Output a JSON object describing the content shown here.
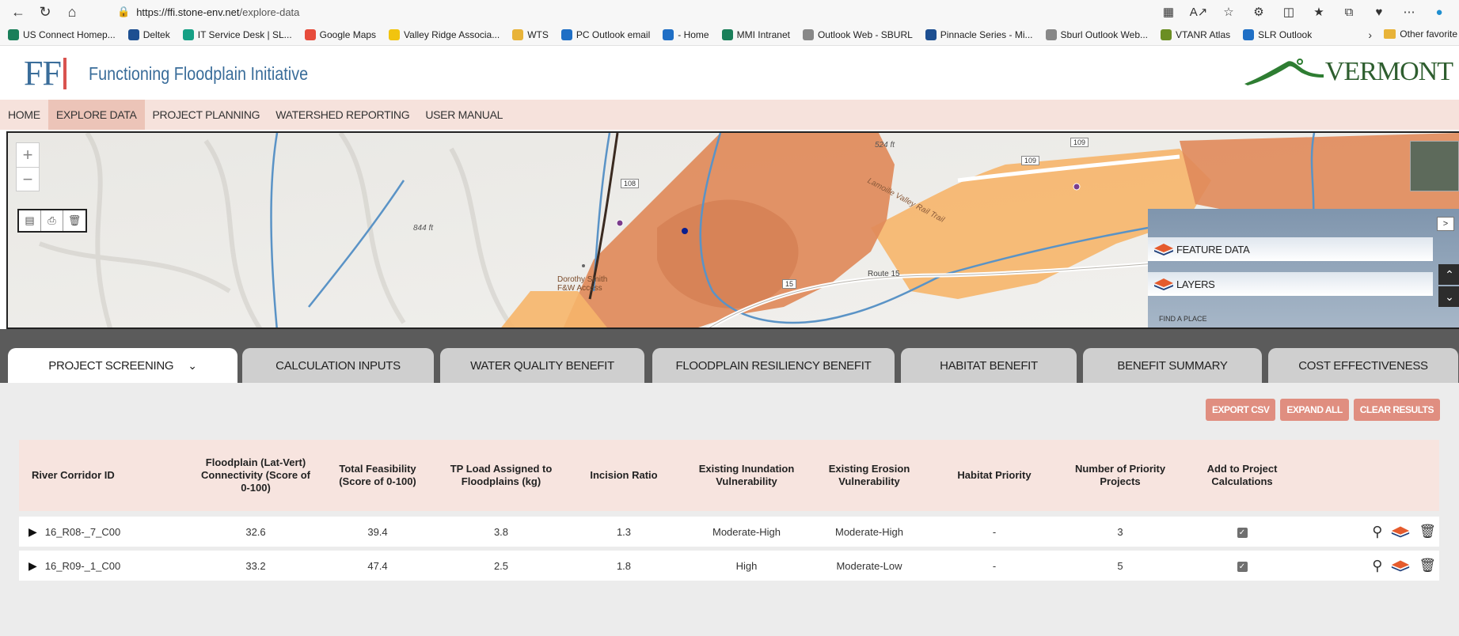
{
  "browser": {
    "url_host": "https://ffi.stone-env.net",
    "url_path": "/explore-data",
    "favorites": [
      {
        "label": "US Connect Homep...",
        "color": "#1a7f5a"
      },
      {
        "label": "Deltek",
        "color": "#1d4f91"
      },
      {
        "label": "IT Service Desk | SL...",
        "color": "#16a085"
      },
      {
        "label": "Google Maps",
        "color": "#e74c3c"
      },
      {
        "label": "Valley Ridge Associa...",
        "color": "#f1c40f"
      },
      {
        "label": "WTS",
        "color": "#e8b339"
      },
      {
        "label": "PC Outlook email",
        "color": "#1f6fc5"
      },
      {
        "label": "- Home",
        "color": "#1f6fc5"
      },
      {
        "label": "MMI Intranet",
        "color": "#1a7f5a"
      },
      {
        "label": "Outlook Web - SBURL",
        "color": "#888888"
      },
      {
        "label": "Pinnacle Series - Mi...",
        "color": "#1d4f91"
      },
      {
        "label": "Sburl Outlook Web...",
        "color": "#888888"
      },
      {
        "label": "VTANR Atlas",
        "color": "#6b8e23"
      },
      {
        "label": "SLR Outlook",
        "color": "#1f6fc5"
      }
    ],
    "other_favorites": "Other favorite"
  },
  "site": {
    "logo": "FF",
    "title": "Functioning Floodplain Initiative",
    "state_logo": "VERMONT"
  },
  "nav": [
    {
      "label": "HOME",
      "active": false
    },
    {
      "label": "EXPLORE DATA",
      "active": true
    },
    {
      "label": "PROJECT PLANNING",
      "active": false
    },
    {
      "label": "WATERSHED REPORTING",
      "active": false
    },
    {
      "label": "USER MANUAL",
      "active": false
    }
  ],
  "map": {
    "labels": {
      "elev1": "844 ft",
      "elev2": "524 ft",
      "place": "Dorothy Smith F&W Access",
      "route": "Route 15",
      "trail": "Lamoille Valley Rail Trail",
      "find": "FIND A PLACE"
    },
    "shields": [
      "108",
      "109",
      "109",
      "15"
    ],
    "panel": {
      "feature_data": "FEATURE DATA",
      "layers": "LAYERS",
      "toggle": ">"
    }
  },
  "tabs": [
    {
      "label": "PROJECT SCREENING",
      "active": true
    },
    {
      "label": "CALCULATION INPUTS",
      "active": false
    },
    {
      "label": "WATER QUALITY BENEFIT",
      "active": false
    },
    {
      "label": "FLOODPLAIN RESILIENCY BENEFIT",
      "active": false
    },
    {
      "label": "HABITAT BENEFIT",
      "active": false
    },
    {
      "label": "BENEFIT SUMMARY",
      "active": false
    },
    {
      "label": "COST EFFECTIVENESS",
      "active": false
    }
  ],
  "actions": {
    "export_csv": "EXPORT CSV",
    "expand_all": "EXPAND ALL",
    "clear_results": "CLEAR RESULTS"
  },
  "table": {
    "headers": [
      "River Corridor ID",
      "Floodplain (Lat-Vert) Connectivity (Score of 0-100)",
      "Total Feasibility (Score of 0-100)",
      "TP Load Assigned to Floodplains (kg)",
      "Incision Ratio",
      "Existing Inundation Vulnerability",
      "Existing Erosion Vulnerability",
      "Habitat Priority",
      "Number of Priority Projects",
      "Add to Project Calculations"
    ],
    "rows": [
      {
        "id": "16_R08-_7_C00",
        "connectivity": "32.6",
        "feasibility": "39.4",
        "tp_load": "3.8",
        "incision": "1.3",
        "inundation": "Moderate-High",
        "erosion": "Moderate-High",
        "habitat": "-",
        "projects": "3",
        "checked": true
      },
      {
        "id": "16_R09-_1_C00",
        "connectivity": "33.2",
        "feasibility": "47.4",
        "tp_load": "2.5",
        "incision": "1.8",
        "inundation": "High",
        "erosion": "Moderate-Low",
        "habitat": "-",
        "projects": "5",
        "checked": true
      }
    ]
  },
  "colors": {
    "nav_bg": "#f6e2dc",
    "nav_active": "#ecc4b8",
    "floodplain_dark": "#e08a5a",
    "floodplain_light": "#f6b56a",
    "button_accent": "#e08e80",
    "brand_blue": "#3a6d9a"
  }
}
